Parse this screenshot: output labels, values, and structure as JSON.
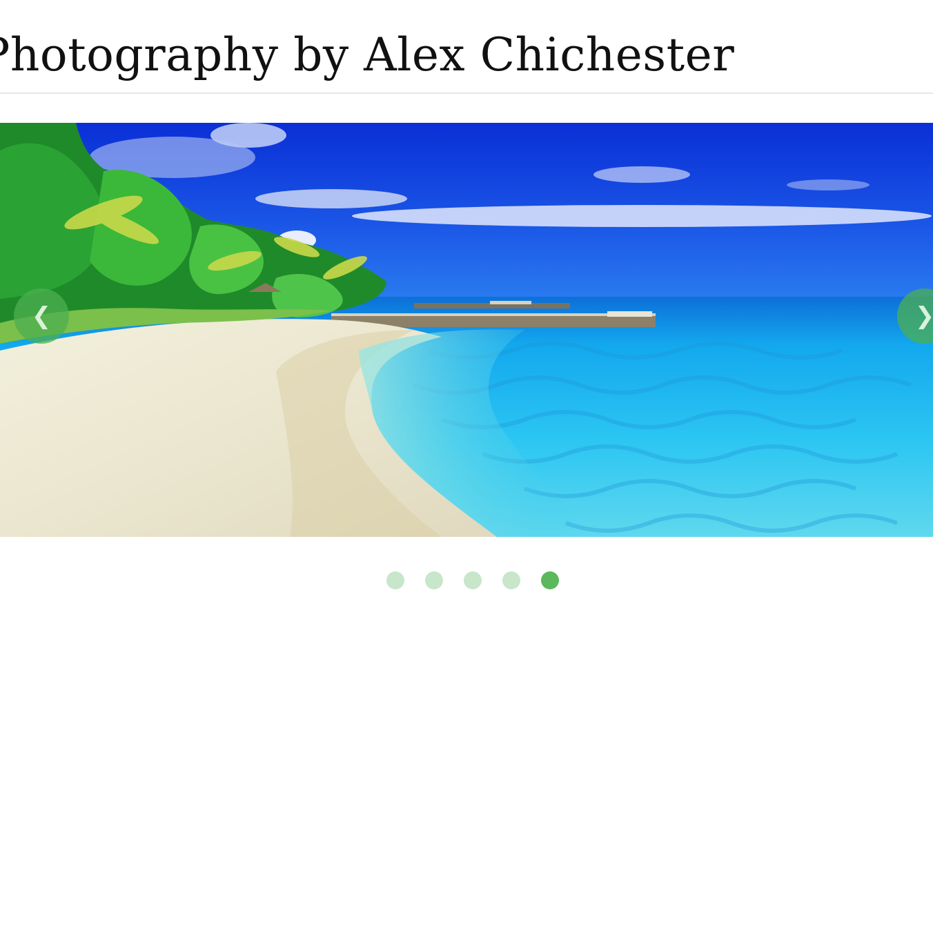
{
  "header": {
    "title": "Photography by Alex Chichester"
  },
  "carousel": {
    "prev_icon": "❮",
    "next_icon": "❯",
    "prev_icon_name": "chevron-left-icon",
    "next_icon_name": "chevron-right-icon",
    "total_slides": 5,
    "active_slide": 5
  },
  "colors": {
    "accent": "#4caf50",
    "dot_inactive": "#c8e6c9",
    "dot_active": "#5cb85c",
    "title_text": "#111111",
    "divider": "#e6e6e6"
  }
}
